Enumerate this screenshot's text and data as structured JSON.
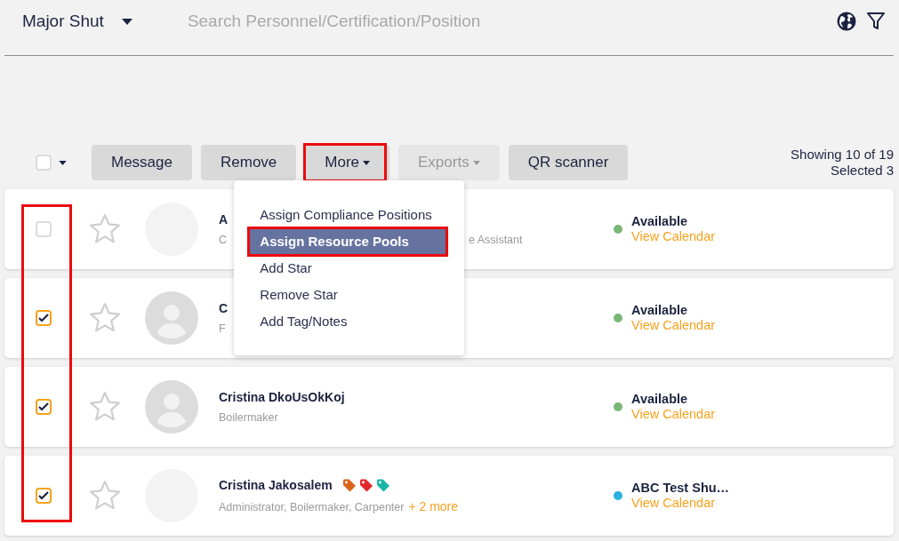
{
  "header": {
    "scope": "Major Shut",
    "search": {
      "placeholder": "Search Personnel/Certification/Position"
    }
  },
  "toolbar": {
    "select_all": {
      "checked": false
    },
    "buttons": [
      {
        "label": "Message",
        "kind": "plain",
        "disabled": false,
        "highlighted": false
      },
      {
        "label": "Remove",
        "kind": "plain",
        "disabled": false,
        "highlighted": false
      },
      {
        "label": "More",
        "kind": "dropdown",
        "disabled": false,
        "highlighted": true
      },
      {
        "label": "Exports",
        "kind": "dropdown",
        "disabled": true,
        "highlighted": false
      },
      {
        "label": "QR scanner",
        "kind": "plain",
        "disabled": false,
        "highlighted": false
      }
    ],
    "showing": "Showing 10 of 19",
    "selected_count": "Selected 3"
  },
  "more_menu": {
    "expanded": true,
    "items": [
      {
        "label": "Assign Compliance Positions",
        "selected": false,
        "highlighted": false
      },
      {
        "label": "Assign Resource Pools",
        "selected": true,
        "highlighted": true
      },
      {
        "label": "Add Star",
        "selected": false,
        "highlighted": false
      },
      {
        "label": "Remove Star",
        "selected": false,
        "highlighted": false
      },
      {
        "label": "Add Tag/Notes",
        "selected": false,
        "highlighted": false
      }
    ]
  },
  "checkboxes_highlighted": true,
  "people": [
    {
      "checked": false,
      "starred": false,
      "avatar": {
        "kind": "blank"
      },
      "name": "A",
      "role": "C",
      "role_tail": "e Assistant",
      "status": "Available",
      "color": "#79b776",
      "calendar": "View Calendar"
    },
    {
      "checked": true,
      "starred": false,
      "avatar": {
        "kind": "silhouette"
      },
      "name": "C",
      "role": "F",
      "status": "Available",
      "color": "#79b776",
      "calendar": "View Calendar"
    },
    {
      "checked": true,
      "starred": false,
      "avatar": {
        "kind": "silhouette"
      },
      "name": "Cristina DkoUsOkKoj",
      "role": "Boilermaker",
      "status": "Available",
      "color": "#79b776",
      "calendar": "View Calendar"
    },
    {
      "checked": true,
      "starred": false,
      "avatar": {
        "kind": "blank"
      },
      "name": "Cristina Jakosalem",
      "role": "Administrator, Boilermaker, Carpenter",
      "tags": [
        {
          "color": "#d9651c"
        },
        {
          "color": "#e0282e"
        },
        {
          "color": "#19b5a9"
        }
      ],
      "more": "+ 2 more",
      "status": "ABC Test Shu…",
      "color": "#2ab0e0",
      "calendar": "View Calendar"
    }
  ]
}
